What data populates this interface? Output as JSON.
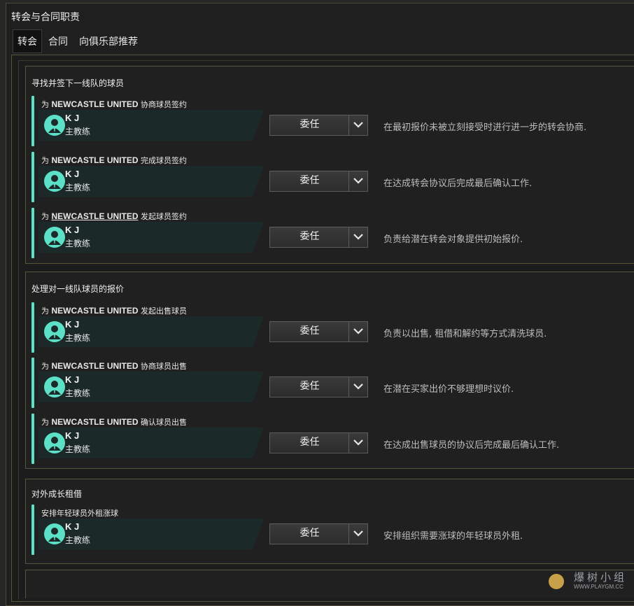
{
  "window": {
    "title": "转会与合同职责"
  },
  "tabs": [
    {
      "label": "转会"
    },
    {
      "label": "合同"
    },
    {
      "label": "向俱乐部推荐"
    }
  ],
  "sections": [
    {
      "title": "寻找并签下一线队的球员",
      "rows": [
        {
          "prefix": "为",
          "club": "NEWCASTLE UNITED",
          "suffix": "协商球员签约",
          "person": "K J",
          "role": "主教练",
          "select": "委任",
          "desc": "在最初报价未被立刻接受时进行进一步的转会协商."
        },
        {
          "prefix": "为",
          "club": "NEWCASTLE UNITED",
          "suffix": "完成球员签约",
          "person": "K J",
          "role": "主教练",
          "select": "委任",
          "desc": "在达成转会协议后完成最后确认工作."
        },
        {
          "prefix": "为",
          "club": "NEWCASTLE UNITED",
          "suffix": "发起球员签约",
          "person": "K J",
          "role": "主教练",
          "select": "委任",
          "desc": "负责给潜在转会对象提供初始报价."
        }
      ]
    },
    {
      "title": "处理对一线队球员的报价",
      "rows": [
        {
          "prefix": "为",
          "club": "NEWCASTLE UNITED",
          "suffix": "发起出售球员",
          "person": "K J",
          "role": "主教练",
          "select": "委任",
          "desc": "负责以出售, 租借和解约等方式清洗球员."
        },
        {
          "prefix": "为",
          "club": "NEWCASTLE UNITED",
          "suffix": "协商球员出售",
          "person": "K J",
          "role": "主教练",
          "select": "委任",
          "desc": "在潜在买家出价不够理想时议价."
        },
        {
          "prefix": "为",
          "club": "NEWCASTLE UNITED",
          "suffix": "确认球员出售",
          "person": "K J",
          "role": "主教练",
          "select": "委任",
          "desc": "在达成出售球员的协议后完成最后确认工作."
        }
      ]
    },
    {
      "title": "对外成长租借",
      "rows": [
        {
          "prefix": "",
          "club": "",
          "suffix": "安排年轻球员外租涨球",
          "person": "K J",
          "role": "主教练",
          "select": "委任",
          "desc": "安排组织需要涨球的年轻球员外租."
        }
      ]
    }
  ],
  "watermark": {
    "text": "爆树小组",
    "url": "WWW.PLAYGM.CC"
  },
  "colors": {
    "accent": "#5de0c8",
    "border": "#5a5538",
    "card": "#1b2a28"
  }
}
